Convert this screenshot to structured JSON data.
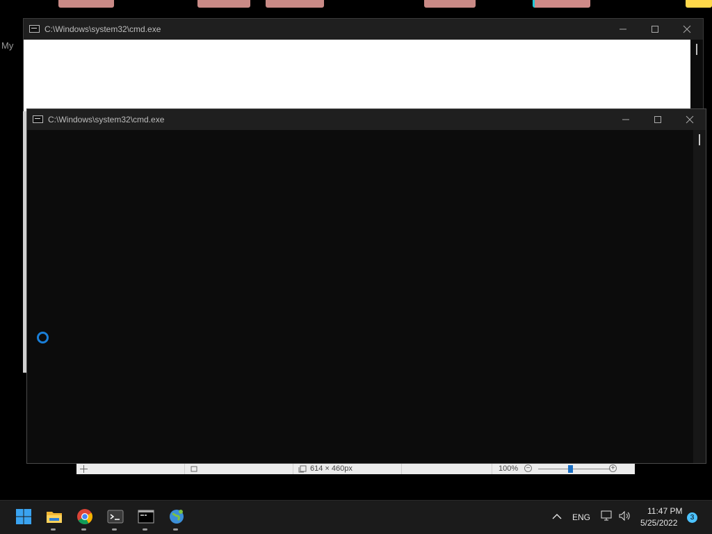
{
  "desktop": {
    "partial_label": "My"
  },
  "window_back": {
    "title": "C:\\Windows\\system32\\cmd.exe"
  },
  "window_front": {
    "title": "C:\\Windows\\system32\\cmd.exe"
  },
  "image_viewer_statusbar": {
    "dimensions": "614 × 460px",
    "zoom": "100%",
    "zoom_out": "−",
    "zoom_in": "+"
  },
  "taskbar": {
    "apps": [
      {
        "name": "Start"
      },
      {
        "name": "File Explorer"
      },
      {
        "name": "Google Chrome"
      },
      {
        "name": "Terminal"
      },
      {
        "name": "Command Prompt"
      },
      {
        "name": "Network"
      }
    ],
    "tray": {
      "language": "ENG",
      "time": "11:47 PM",
      "date": "5/25/2022",
      "notification_count": "3"
    }
  },
  "colors": {
    "taskbar_bg": "#1b1b1b",
    "console_bg": "#0c0c0c",
    "accent": "#1a7fd8"
  }
}
